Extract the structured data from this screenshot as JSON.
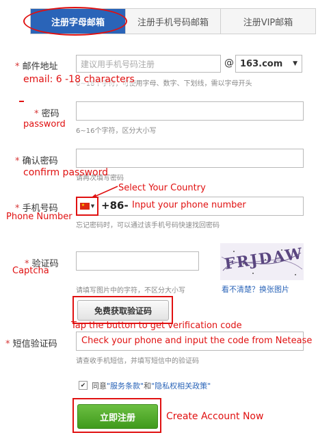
{
  "tabs": [
    {
      "label": "注册字母邮箱",
      "active": true
    },
    {
      "label": "注册手机号码邮箱",
      "active": false
    },
    {
      "label": "注册VIP邮箱",
      "active": false
    }
  ],
  "email": {
    "label": "邮件地址",
    "placeholder": "建议用手机号码注册",
    "at": "@",
    "domain": "163.com",
    "hint": "6~18个字符，可使用字母、数字、下划线，需以字母开头",
    "annotation": "email: 6 -18 characters"
  },
  "password": {
    "label": "密码",
    "hint": "6~16个字符，区分大小写",
    "annotation": "password"
  },
  "confirm": {
    "label": "确认密码",
    "hint": "请再次填写密码",
    "annotation": "confirm password"
  },
  "phone": {
    "label": "手机号码",
    "prefix": "+86-",
    "hint": "忘记密码时，可以通过该手机号码快速找回密码",
    "annotation_country": "Select Your Country",
    "annotation_label": "Phone Number",
    "annotation_input": "Input your phone number"
  },
  "captcha": {
    "label": "验证码",
    "hint": "请填写图片中的字符，不区分大小写",
    "refresh_link": "看不清楚？换张图片",
    "annotation": "Captcha",
    "image_text": "FRJDAW"
  },
  "sms": {
    "button": "免费获取验证码",
    "annotation_button": "Tap the button to get verification code",
    "label": "短信验证码",
    "hint": "请查收手机短信，并填写短信中的验证码",
    "annotation_input": "Check your phone and input the code from Netease"
  },
  "agree": {
    "text_prefix": "同意",
    "terms": "\"服务条款\"",
    "and": "和",
    "privacy": "\"隐私权相关政策\"",
    "checked": true
  },
  "submit": {
    "label": "立即注册",
    "annotation": "Create Account Now"
  },
  "colors": {
    "tab_active": "#2a64b8",
    "annotation": "#e01010",
    "submit": "#4aa82a"
  }
}
